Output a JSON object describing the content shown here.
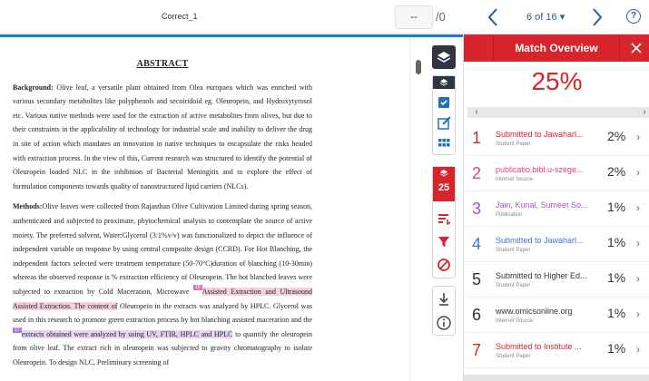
{
  "header": {
    "submission_title": "Correct_1",
    "score_value": "--",
    "score_max": "/0",
    "page_counter": "6 of 16 ▾",
    "help_label": "?"
  },
  "document": {
    "heading": "ABSTRACT",
    "background_lead": "Background:",
    "background_text": " Olive leaf, a versatile plant obtained from Olea europaea which was enriched with various secondary metabolites like polyphenols and secoiridoid eg. Oleuropein, and Hydroxytyrosol etc. Various native methods were used for the extraction of active metabolites from olives, but due to their constraints in the applicability of technology for industrial scale and inability to deliver the drug in site of action which mandates an innovation in native techniques to encapsulate the risks headed with extraction process. In the view of this, Current research was structured to identify the potential of Oleuropein loaded NLC in the inhibition of Bacterial Meningitis and to explore the effect of formulation components towards quality of nanostructured lipid carriers (NLCs).",
    "methods_lead": "Methods:",
    "methods_text_1": "Olive leaves were collected from Rajasthan Olive Cultivation Limited during spring season, authenticated and subjected to proximate, phytochemical analysis to contemplate the source of active moiety. The preferred solvent, Water:Glycerol (3:1%v/v) was functionalized to depict the influence of independent variable on response by using central composite design (CCRD). For Hot Blanching, the independent factors selected were treatment temperature (50-70°C)duration of blanching (10-30min) whereas the observed response is % extraction efficiency of Oleuropein. The hot blanched leaves were subjected to extraction by Cold Maceration, Microwave ",
    "methods_hl_1": "Assisted Extraction and Ultrasound Assisted Extraction. The content of",
    "methods_text_2": " Oleuropein in the extracts was analyzed by HPLC. Glycerol was used in this research to promote green extraction process by hot blanching assisted maceration and the ",
    "methods_hl_2": "extracts obtained were analyzed by using UV, FTIR, HPLC and HPLC",
    "methods_text_3": " to quantify the oleuropein from olive leaf. The extract rich in oleuropein was subjected to gravity chromatography to isolate Oleuropein. To design NLC, Preliminary screening of",
    "marker_a": "18",
    "marker_b": "2",
    "marker_c": "17"
  },
  "toolbar": {
    "layers_count": "",
    "match_count": "25"
  },
  "panel": {
    "title": "Match Overview",
    "overall_similarity": "25%",
    "matches": [
      {
        "num": "1",
        "source": "Submitted to Jawaharl...",
        "type": "Student Paper",
        "pct": "2%",
        "color": "#d8242b"
      },
      {
        "num": "2",
        "source": "publicatio.bibl.u-szege...",
        "type": "Internet Source",
        "pct": "2%",
        "color": "#e0407e"
      },
      {
        "num": "3",
        "source": "Jain, Kunal, Sumeet So...",
        "type": "Publication",
        "pct": "1%",
        "color": "#a855c8"
      },
      {
        "num": "4",
        "source": "Submitted to Jawaharl...",
        "type": "Student Paper",
        "pct": "1%",
        "color": "#3a78c9"
      },
      {
        "num": "5",
        "source": "Submitted to Higher Ed...",
        "type": "Student Paper",
        "pct": "1%",
        "color": "#333333"
      },
      {
        "num": "6",
        "source": "www.omicsonline.org",
        "type": "Internet Source",
        "pct": "1%",
        "color": "#333333"
      },
      {
        "num": "7",
        "source": "Submitted to Institute ...",
        "type": "Student Paper",
        "pct": "1%",
        "color": "#d8242b"
      }
    ]
  },
  "colors": {
    "accent_red": "#d8242b",
    "accent_blue": "#1f5fa8",
    "toolbar_dark": "#2e3641"
  }
}
